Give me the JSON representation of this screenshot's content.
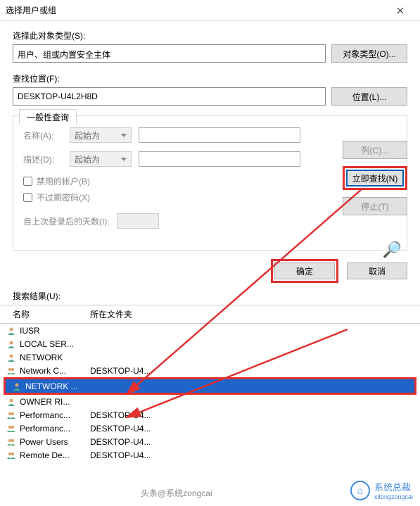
{
  "title": "选择用户或组",
  "section1_label": "选择此对象类型(S):",
  "object_type_value": "用户、组或内置安全主体",
  "object_type_button": "对象类型(O)...",
  "section2_label": "查找位置(F):",
  "location_value": "DESKTOP-U4L2H8D",
  "location_button": "位置(L)...",
  "tab_label": "一般性查询",
  "name_label": "名称(A):",
  "name_combo": "起始为",
  "desc_label": "描述(D):",
  "desc_combo": "起始为",
  "disabled_accounts_label": "禁用的帐户(B)",
  "no_expire_label": "不过期密码(X)",
  "days_label": "自上次登录后的天数(I):",
  "columns_button": "列(C)...",
  "find_now_button": "立即查找(N)",
  "stop_button": "停止(T)",
  "ok_button": "确定",
  "cancel_button": "取消",
  "results_label": "搜索结果(U):",
  "col_name_header": "名称",
  "col_location_header": "所在文件夹",
  "results": [
    {
      "name": "IUSR",
      "location": "",
      "type": "user"
    },
    {
      "name": "LOCAL SER...",
      "location": "",
      "type": "user"
    },
    {
      "name": "NETWORK",
      "location": "",
      "type": "user"
    },
    {
      "name": "Network C...",
      "location": "DESKTOP-U4...",
      "type": "group"
    },
    {
      "name": "NETWORK ...",
      "location": "",
      "type": "user",
      "selected": true
    },
    {
      "name": "OWNER RI...",
      "location": "",
      "type": "user"
    },
    {
      "name": "Performanc...",
      "location": "DESKTOP-U4...",
      "type": "group"
    },
    {
      "name": "Performanc...",
      "location": "DESKTOP-U4...",
      "type": "group"
    },
    {
      "name": "Power Users",
      "location": "DESKTOP-U4...",
      "type": "group"
    },
    {
      "name": "Remote De...",
      "location": "DESKTOP-U4...",
      "type": "group"
    }
  ],
  "watermark_text": "系统总裁",
  "toutiao_text": "头条@系统zongcai",
  "watermark_sub": "xitongzongcai"
}
